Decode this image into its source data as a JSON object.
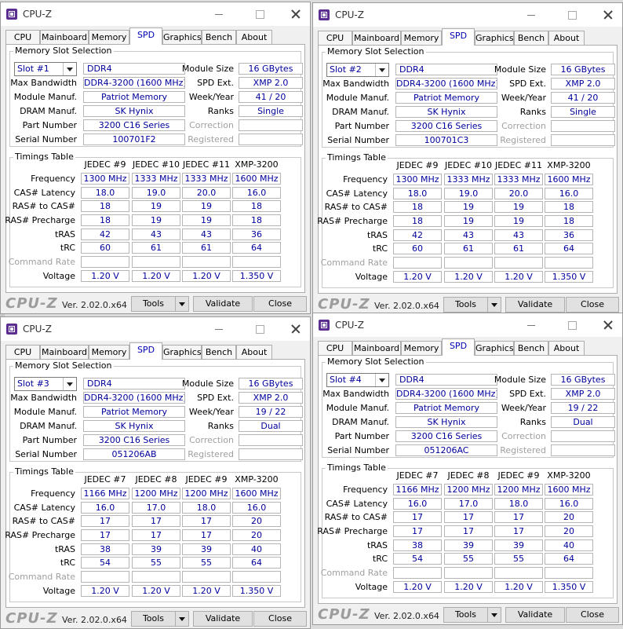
{
  "tabs": [
    "CPU",
    "Mainboard",
    "Memory",
    "SPD",
    "Graphics",
    "Bench",
    "About"
  ],
  "labels": {
    "window_title": "CPU-Z",
    "slot_group": "Memory Slot Selection",
    "timings_group": "Timings Table",
    "max_bandwidth": "Max Bandwidth",
    "module_manuf": "Module Manuf.",
    "dram_manuf": "DRAM Manuf.",
    "part_number": "Part Number",
    "serial_number": "Serial Number",
    "module_size": "Module Size",
    "spd_ext": "SPD Ext.",
    "week_year": "Week/Year",
    "ranks": "Ranks",
    "correction": "Correction",
    "registered": "Registered",
    "frequency": "Frequency",
    "cas_latency": "CAS# Latency",
    "ras_to_cas": "RAS# to CAS#",
    "ras_precharge": "RAS# Precharge",
    "tras": "tRAS",
    "trc": "tRC",
    "command_rate": "Command Rate",
    "voltage": "Voltage",
    "logo": "CPU-Z",
    "version": "Ver. 2.02.0.x64",
    "tools": "Tools",
    "validate": "Validate",
    "close": "Close"
  },
  "windows": [
    {
      "slot": "Slot #1",
      "mem_type": "DDR4",
      "module_size": "16 GBytes",
      "max_bandwidth": "DDR4-3200 (1600 MHz)",
      "spd_ext": "XMP 2.0",
      "module_manuf": "Patriot Memory",
      "week_year": "41 / 20",
      "dram_manuf": "SK Hynix",
      "ranks": "Single",
      "part_number": "3200 C16 Series",
      "serial_number": "100701F2",
      "timing_headers": [
        "JEDEC #9",
        "JEDEC #10",
        "JEDEC #11",
        "XMP-3200"
      ],
      "frequency": [
        "1300 MHz",
        "1333 MHz",
        "1333 MHz",
        "1600 MHz"
      ],
      "cas": [
        "18.0",
        "19.0",
        "20.0",
        "16.0"
      ],
      "rcd": [
        "18",
        "19",
        "19",
        "18"
      ],
      "rp": [
        "18",
        "19",
        "19",
        "18"
      ],
      "tras": [
        "42",
        "43",
        "43",
        "36"
      ],
      "trc": [
        "60",
        "61",
        "61",
        "64"
      ],
      "voltage": [
        "1.20 V",
        "1.20 V",
        "1.20 V",
        "1.350 V"
      ]
    },
    {
      "slot": "Slot #2",
      "mem_type": "DDR4",
      "module_size": "16 GBytes",
      "max_bandwidth": "DDR4-3200 (1600 MHz)",
      "spd_ext": "XMP 2.0",
      "module_manuf": "Patriot Memory",
      "week_year": "41 / 20",
      "dram_manuf": "SK Hynix",
      "ranks": "Single",
      "part_number": "3200 C16 Series",
      "serial_number": "100701C3",
      "timing_headers": [
        "JEDEC #9",
        "JEDEC #10",
        "JEDEC #11",
        "XMP-3200"
      ],
      "frequency": [
        "1300 MHz",
        "1333 MHz",
        "1333 MHz",
        "1600 MHz"
      ],
      "cas": [
        "18.0",
        "19.0",
        "20.0",
        "16.0"
      ],
      "rcd": [
        "18",
        "19",
        "19",
        "18"
      ],
      "rp": [
        "18",
        "19",
        "19",
        "18"
      ],
      "tras": [
        "42",
        "43",
        "43",
        "36"
      ],
      "trc": [
        "60",
        "61",
        "61",
        "64"
      ],
      "voltage": [
        "1.20 V",
        "1.20 V",
        "1.20 V",
        "1.350 V"
      ]
    },
    {
      "slot": "Slot #3",
      "mem_type": "DDR4",
      "module_size": "16 GBytes",
      "max_bandwidth": "DDR4-3200 (1600 MHz)",
      "spd_ext": "XMP 2.0",
      "module_manuf": "Patriot Memory",
      "week_year": "19 / 22",
      "dram_manuf": "SK Hynix",
      "ranks": "Dual",
      "part_number": "3200 C16 Series",
      "serial_number": "051206AB",
      "timing_headers": [
        "JEDEC #7",
        "JEDEC #8",
        "JEDEC #9",
        "XMP-3200"
      ],
      "frequency": [
        "1166 MHz",
        "1200 MHz",
        "1200 MHz",
        "1600 MHz"
      ],
      "cas": [
        "16.0",
        "17.0",
        "18.0",
        "16.0"
      ],
      "rcd": [
        "17",
        "17",
        "17",
        "20"
      ],
      "rp": [
        "17",
        "17",
        "17",
        "20"
      ],
      "tras": [
        "38",
        "39",
        "39",
        "40"
      ],
      "trc": [
        "54",
        "55",
        "55",
        "64"
      ],
      "voltage": [
        "1.20 V",
        "1.20 V",
        "1.20 V",
        "1.350 V"
      ]
    },
    {
      "slot": "Slot #4",
      "mem_type": "DDR4",
      "module_size": "16 GBytes",
      "max_bandwidth": "DDR4-3200 (1600 MHz)",
      "spd_ext": "XMP 2.0",
      "module_manuf": "Patriot Memory",
      "week_year": "19 / 22",
      "dram_manuf": "SK Hynix",
      "ranks": "Dual",
      "part_number": "3200 C16 Series",
      "serial_number": "051206AC",
      "timing_headers": [
        "JEDEC #7",
        "JEDEC #8",
        "JEDEC #9",
        "XMP-3200"
      ],
      "frequency": [
        "1166 MHz",
        "1200 MHz",
        "1200 MHz",
        "1600 MHz"
      ],
      "cas": [
        "16.0",
        "17.0",
        "18.0",
        "16.0"
      ],
      "rcd": [
        "17",
        "17",
        "17",
        "20"
      ],
      "rp": [
        "17",
        "17",
        "17",
        "20"
      ],
      "tras": [
        "38",
        "39",
        "39",
        "40"
      ],
      "trc": [
        "54",
        "55",
        "55",
        "64"
      ],
      "voltage": [
        "1.20 V",
        "1.20 V",
        "1.20 V",
        "1.350 V"
      ]
    }
  ]
}
